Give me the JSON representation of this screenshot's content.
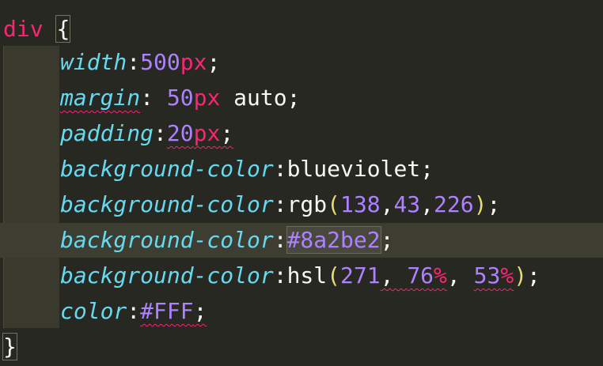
{
  "editor": {
    "line0": {
      "selector": "div",
      "open": "{"
    },
    "line1": {
      "prop": "width",
      "colon": ":",
      "num": "500",
      "unit": "px",
      "semi": ";"
    },
    "line2": {
      "prop": "margin",
      "colon": ":",
      "space": " ",
      "num": "50",
      "unit": "px",
      "rest": " auto",
      "semi": ";"
    },
    "line3": {
      "prop": "padding",
      "colon": ":",
      "num": "20",
      "unit": "px",
      "semi": ";"
    },
    "line4": {
      "prop": "background-color",
      "colon": ":",
      "value": "blueviolet",
      "semi": ";"
    },
    "line5": {
      "prop": "background-color",
      "colon": ":",
      "fn": "rgb",
      "lp": "(",
      "a": "138",
      "c1": ",",
      "b": "43",
      "c2": ",",
      "c": "226",
      "rp": ")",
      "semi": ";"
    },
    "line6": {
      "prop": "background-color",
      "colon": ":",
      "hash": "#8a2be2",
      "semi": ";"
    },
    "line7": {
      "prop": "background-color",
      "colon": ":",
      "fn": "hsl",
      "lp": "(",
      "a": "271",
      "c1": ", ",
      "b": "76",
      "p1": "%",
      "c2": ", ",
      "c": "53",
      "p2": "%",
      "rp": ")",
      "semi": ";"
    },
    "line8": {
      "prop": "color",
      "colon": ":",
      "hash": "#FFF",
      "semi": ";"
    },
    "line9": {
      "close": "}"
    }
  },
  "colors": {
    "background": "#272822",
    "selector": "#f92672",
    "property": "#66d9ef",
    "number": "#ae81ff",
    "unit": "#f92672",
    "text": "#f8f8f2"
  }
}
